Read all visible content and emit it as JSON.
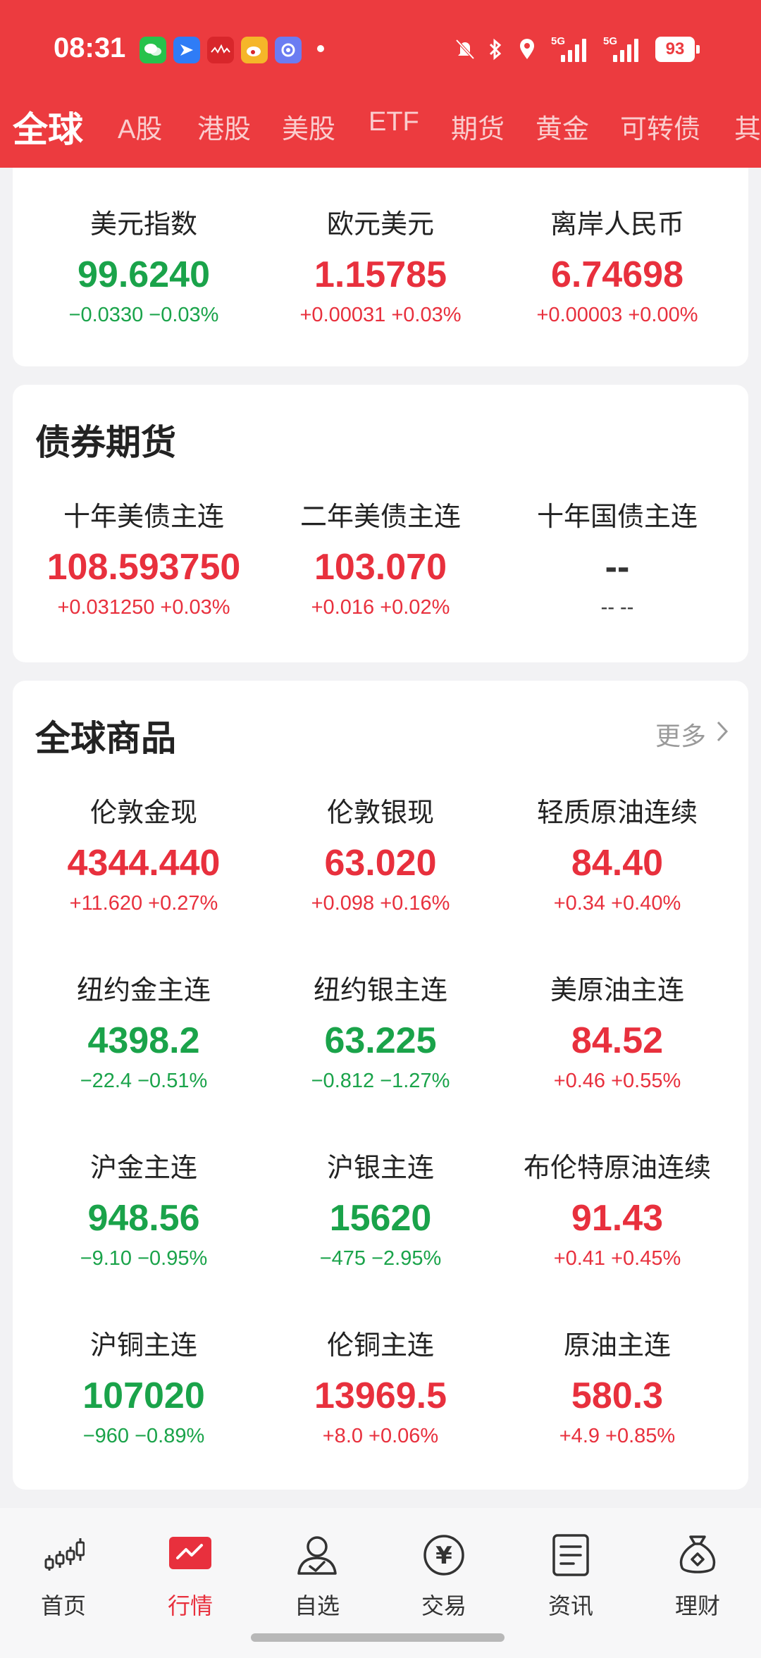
{
  "status_bar": {
    "time": "08:31",
    "network_1": "5G",
    "network_2": "5G",
    "battery": "93"
  },
  "tabs": [
    "全球",
    "A股",
    "港股",
    "美股",
    "ETF",
    "期货",
    "黄金",
    "可转债",
    "其"
  ],
  "forex_card": {
    "items": [
      {
        "name": "美元指数",
        "price": "99.6240",
        "change": "−0.0330  −0.03%",
        "trend": "down"
      },
      {
        "name": "欧元美元",
        "price": "1.15785",
        "change": "+0.00031  +0.03%",
        "trend": "up"
      },
      {
        "name": "离岸人民币",
        "price": "6.74698",
        "change": "+0.00003  +0.00%",
        "trend": "up"
      }
    ]
  },
  "bond_card": {
    "title": "债券期货",
    "items": [
      {
        "name": "十年美债主连",
        "price": "108.593750",
        "change": "+0.031250  +0.03%",
        "trend": "up"
      },
      {
        "name": "二年美债主连",
        "price": "103.070",
        "change": "+0.016  +0.02%",
        "trend": "up"
      },
      {
        "name": "十年国债主连",
        "price": "--",
        "change": "-- --",
        "trend": "flat"
      }
    ]
  },
  "commodity_card": {
    "title": "全球商品",
    "more_label": "更多",
    "items": [
      {
        "name": "伦敦金现",
        "price": "4344.440",
        "change": "+11.620  +0.27%",
        "trend": "up"
      },
      {
        "name": "伦敦银现",
        "price": "63.020",
        "change": "+0.098  +0.16%",
        "trend": "up"
      },
      {
        "name": "轻质原油连续",
        "price": "84.40",
        "change": "+0.34  +0.40%",
        "trend": "up"
      },
      {
        "name": "纽约金主连",
        "price": "4398.2",
        "change": "−22.4  −0.51%",
        "trend": "down"
      },
      {
        "name": "纽约银主连",
        "price": "63.225",
        "change": "−0.812  −1.27%",
        "trend": "down"
      },
      {
        "name": "美原油主连",
        "price": "84.52",
        "change": "+0.46  +0.55%",
        "trend": "up"
      },
      {
        "name": "沪金主连",
        "price": "948.56",
        "change": "−9.10  −0.95%",
        "trend": "down"
      },
      {
        "name": "沪银主连",
        "price": "15620",
        "change": "−475  −2.95%",
        "trend": "down"
      },
      {
        "name": "布伦特原油连续",
        "price": "91.43",
        "change": "+0.41  +0.45%",
        "trend": "up"
      },
      {
        "name": "沪铜主连",
        "price": "107020",
        "change": "−960  −0.89%",
        "trend": "down"
      },
      {
        "name": "伦铜主连",
        "price": "13969.5",
        "change": "+8.0  +0.06%",
        "trend": "up"
      },
      {
        "name": "原油主连",
        "price": "580.3",
        "change": "+4.9  +0.85%",
        "trend": "up"
      }
    ]
  },
  "bottom_nav": [
    {
      "label": "首页",
      "icon": "candlestick-icon"
    },
    {
      "label": "行情",
      "icon": "market-chart-icon"
    },
    {
      "label": "自选",
      "icon": "user-check-icon"
    },
    {
      "label": "交易",
      "icon": "yuan-icon"
    },
    {
      "label": "资讯",
      "icon": "document-icon"
    },
    {
      "label": "理财",
      "icon": "money-bag-icon"
    }
  ],
  "colors": {
    "brand_red": "#ec3b3f",
    "up": "#e8303d",
    "down": "#1aa34a"
  }
}
